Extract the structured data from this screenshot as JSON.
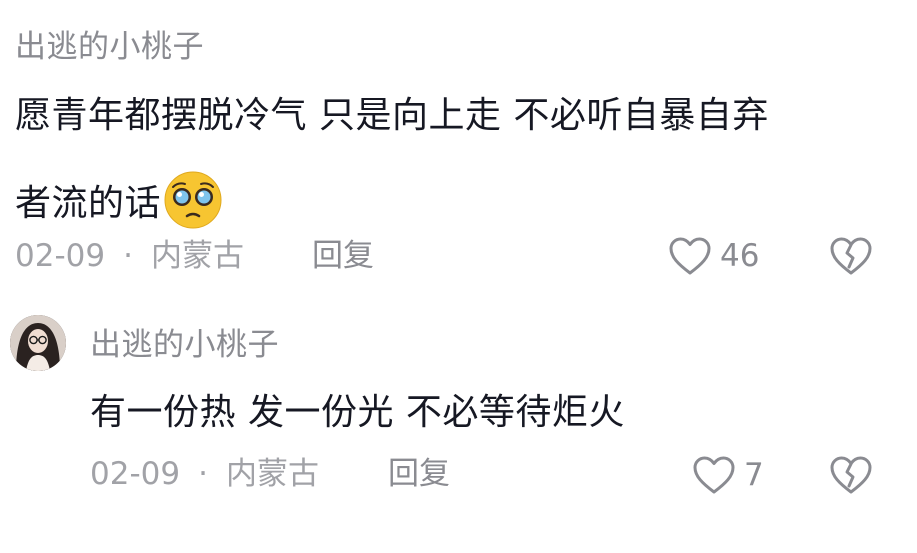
{
  "comments": [
    {
      "username": "出逃的小桃子",
      "lines": [
        "愿青年都摆脱冷气 只是向上走 不必听自暴自弃",
        "者流的话"
      ],
      "emoji": "pleading-face-emoji",
      "date": "02-09",
      "separator": "·",
      "location": "内蒙古",
      "reply_label": "回复",
      "likes": "46",
      "icons": {
        "like": "heart-outline-icon",
        "dislike": "broken-heart-icon"
      }
    },
    {
      "username": "出逃的小桃子",
      "avatar": "user-avatar",
      "lines": [
        "有一份热 发一份光 不必等待炬火"
      ],
      "date": "02-09",
      "separator": "·",
      "location": "内蒙古",
      "reply_label": "回复",
      "likes": "7",
      "icons": {
        "like": "heart-outline-icon",
        "dislike": "broken-heart-icon"
      }
    }
  ],
  "colors": {
    "text": "#161823",
    "secondary": "#8a8b91",
    "meta": "#a1a2a7",
    "emoji": "#f7c531"
  }
}
